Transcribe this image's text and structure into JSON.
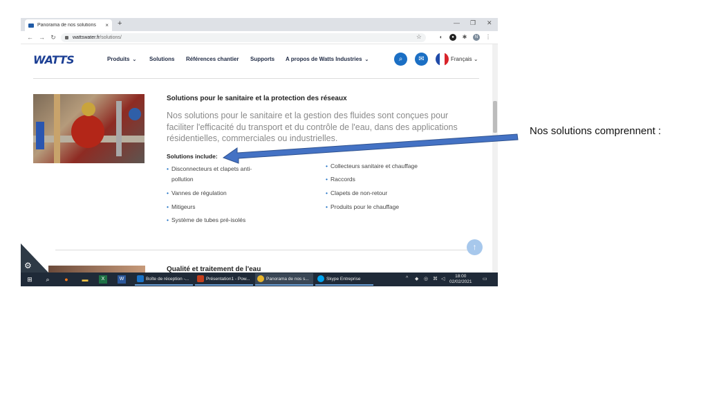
{
  "browser": {
    "tab_title": "Panorama de nos solutions",
    "tab_close": "×",
    "new_tab": "+",
    "url_host": "wattswater.fr",
    "url_path": "/solutions/",
    "profile_initial": "N"
  },
  "site": {
    "logo": "WATTS",
    "nav": [
      {
        "label": "Produits",
        "chevron": "⌄"
      },
      {
        "label": "Solutions"
      },
      {
        "label": "Références chantier"
      },
      {
        "label": "Supports"
      },
      {
        "label": "A propos de Watts Industries",
        "chevron": "⌄"
      }
    ],
    "language": "Français",
    "language_chevron": "⌄",
    "brand_color": "#1c3f94",
    "accent_color": "#1b6fc4"
  },
  "section": {
    "title": "Solutions pour le sanitaire et la protection des réseaux",
    "lead": "Nos solutions pour le sanitaire et la gestion des fluides sont conçues pour faciliter l'efficacité du transport et du contrôle de l'eau, dans des applications résidentielles, commerciales ou industrielles.",
    "include_heading": "Solutions include:",
    "left_items": [
      "Disconnecteurs et clapets anti-",
      "pollution",
      "Vannes de régulation",
      "Mitigeurs",
      "Système de tubes pré-isolés"
    ],
    "right_items": [
      "Collecteurs sanitaire et chauffage",
      "Raccords",
      "Clapets de non-retour",
      "Produits pour le chauffage"
    ],
    "next_title": "Qualité et traitement de l'eau"
  },
  "taskbar": {
    "apps": [
      {
        "label": "Boîte de réception -...",
        "color": "#1a73c8"
      },
      {
        "label": "Présentation1 - Pow...",
        "color": "#c43e1c"
      },
      {
        "label": "Panorama de nos s...",
        "color": "#e8b52c"
      },
      {
        "label": "Skype Entreprise",
        "color": "#00a4ef"
      }
    ],
    "time": "18:00",
    "date": "02/02/2021"
  },
  "annotation": {
    "text": "Nos solutions comprennent :"
  }
}
